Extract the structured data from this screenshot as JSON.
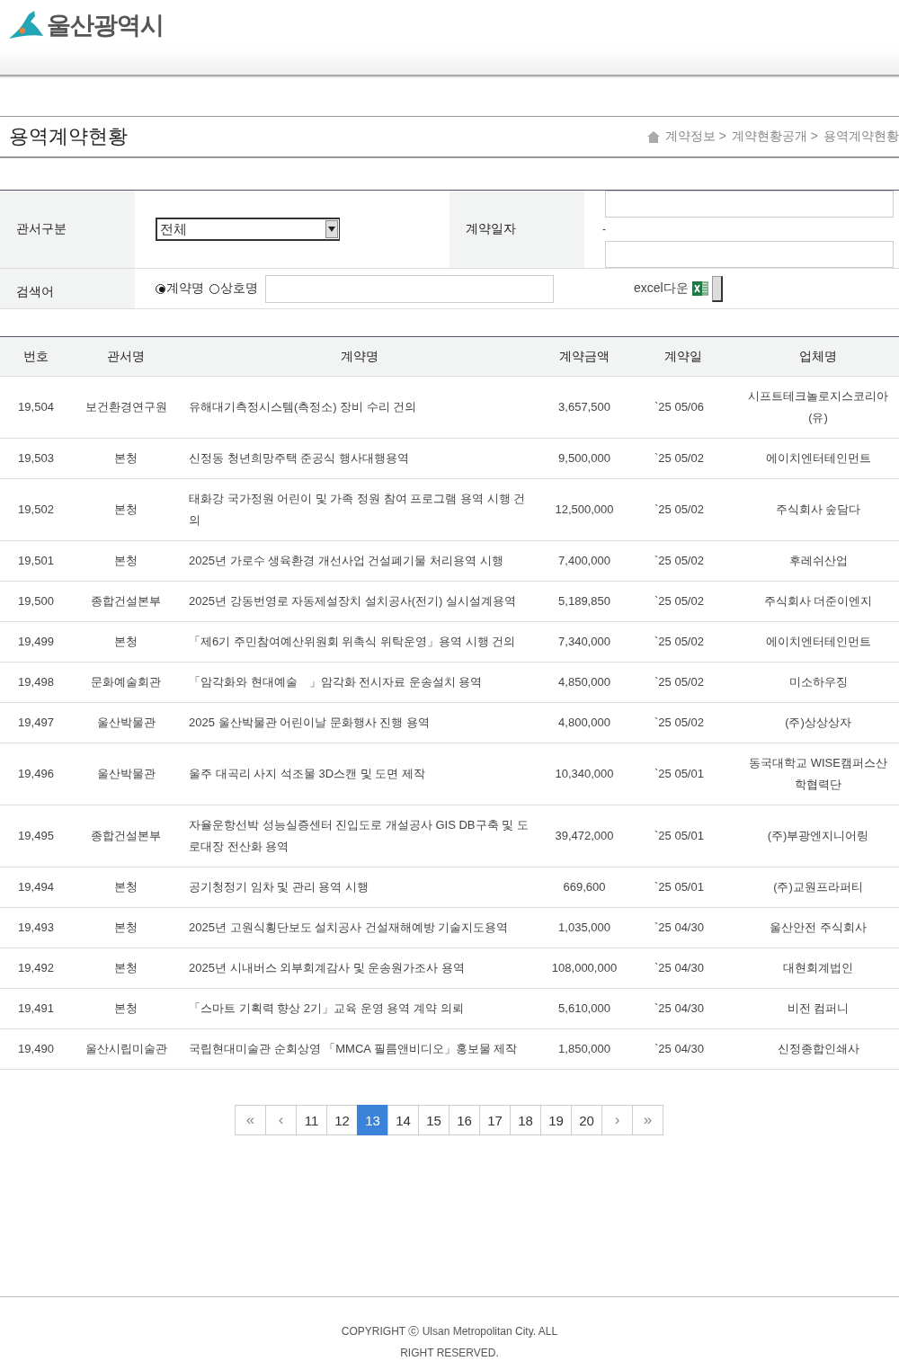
{
  "header": {
    "logo_text": "울산광역시"
  },
  "page_title": "용역계약현황",
  "breadcrumb": [
    {
      "label": "계약정보 >"
    },
    {
      "label": "계약현황공개 >"
    },
    {
      "label": "용역계약현황"
    }
  ],
  "filters": {
    "office_label": "관서구분",
    "office_value": "전체",
    "date_label": "계약일자",
    "date_separator": "-",
    "search_label": "검색어",
    "search_options": [
      {
        "label": "계약명",
        "selected": true
      },
      {
        "label": "상호명",
        "selected": false
      }
    ],
    "excel_label": "excel다운"
  },
  "table": {
    "columns": [
      "번호",
      "관서명",
      "계약명",
      "계약금액",
      "계약일",
      "업체명"
    ],
    "rows": [
      [
        "19,504",
        "보건환경연구원",
        "유해대기측정시스템(측정소) 장비 수리 건의",
        "3,657,500",
        "`25 05/06",
        "시프트테크놀로지스코리아(유)"
      ],
      [
        "19,503",
        "본청",
        "신정동 청년희망주택 준공식 행사대행용역",
        "9,500,000",
        "`25 05/02",
        "에이치엔터테인먼트"
      ],
      [
        "19,502",
        "본청",
        "태화강 국가정원 어린이 및 가족 정원 참여 프로그램 용역 시행 건의",
        "12,500,000",
        "`25 05/02",
        "주식회사 숲담다"
      ],
      [
        "19,501",
        "본청",
        "2025년 가로수 생육환경 개선사업 건설폐기물 처리용역 시행",
        "7,400,000",
        "`25 05/02",
        "후레쉬산업"
      ],
      [
        "19,500",
        "종합건설본부",
        "2025년 강동번영로 자동제설장치 설치공사(전기) 실시설계용역",
        "5,189,850",
        "`25 05/02",
        "주식회사 더준이엔지"
      ],
      [
        "19,499",
        "본청",
        "「제6기 주민참여예산위원회 위촉식 위탁운영」용역 시행 건의",
        "7,340,000",
        "`25 05/02",
        "에이치엔터테인먼트"
      ],
      [
        "19,498",
        "문화예술회관",
        "「암각화와 현대예술　」암각화 전시자료 운송설치 용역",
        "4,850,000",
        "`25 05/02",
        "미소하우징"
      ],
      [
        "19,497",
        "울산박물관",
        "2025 울산박물관 어린이날 문화행사 진행 용역",
        "4,800,000",
        "`25 05/02",
        "(주)상상상자"
      ],
      [
        "19,496",
        "울산박물관",
        "울주 대곡리 사지 석조물 3D스캔 및 도면 제작",
        "10,340,000",
        "`25 05/01",
        "동국대학교 WISE캠퍼스산학협력단"
      ],
      [
        "19,495",
        "종합건설본부",
        "자율운항선박 성능실증센터 진입도로 개설공사 GIS DB구축 및 도로대장 전산화 용역",
        "39,472,000",
        "`25 05/01",
        "(주)부광엔지니어링"
      ],
      [
        "19,494",
        "본청",
        "공기청정기 임차 및 관리 용역 시행",
        "669,600",
        "`25 05/01",
        "(주)교원프라퍼티"
      ],
      [
        "19,493",
        "본청",
        "2025년 고원식횡단보도 설치공사 건설재해예방 기술지도용역",
        "1,035,000",
        "`25 04/30",
        "울산안전 주식회사"
      ],
      [
        "19,492",
        "본청",
        "2025년 시내버스 외부회계감사 및 운송원가조사 용역",
        "108,000,000",
        "`25 04/30",
        "대현회계법인"
      ],
      [
        "19,491",
        "본청",
        "「스마트 기획력 향상 2기」교육 운영 용역 계약 의뢰",
        "5,610,000",
        "`25 04/30",
        "비전 컴퍼니"
      ],
      [
        "19,490",
        "울산시립미술관",
        "국립현대미술관 순회상영 「MMCA 필름앤비디오」홍보물 제작",
        "1,850,000",
        "`25 04/30",
        "신정종합인쇄사"
      ]
    ]
  },
  "pagination": [
    {
      "label": "«",
      "kind": "nav",
      "selected": false
    },
    {
      "label": "‹",
      "kind": "nav",
      "selected": false
    },
    {
      "label": "11",
      "kind": "page",
      "selected": false
    },
    {
      "label": "12",
      "kind": "page",
      "selected": false
    },
    {
      "label": "13",
      "kind": "page",
      "selected": true
    },
    {
      "label": "14",
      "kind": "page",
      "selected": false
    },
    {
      "label": "15",
      "kind": "page",
      "selected": false
    },
    {
      "label": "16",
      "kind": "page",
      "selected": false
    },
    {
      "label": "17",
      "kind": "page",
      "selected": false
    },
    {
      "label": "18",
      "kind": "page",
      "selected": false
    },
    {
      "label": "19",
      "kind": "page",
      "selected": false
    },
    {
      "label": "20",
      "kind": "page",
      "selected": false
    },
    {
      "label": "›",
      "kind": "nav",
      "selected": false
    },
    {
      "label": "»",
      "kind": "nav",
      "selected": false
    }
  ],
  "footer": {
    "copyright": "COPYRIGHT ⓒ Ulsan Metropolitan City. ALL RIGHT RESERVED."
  }
}
